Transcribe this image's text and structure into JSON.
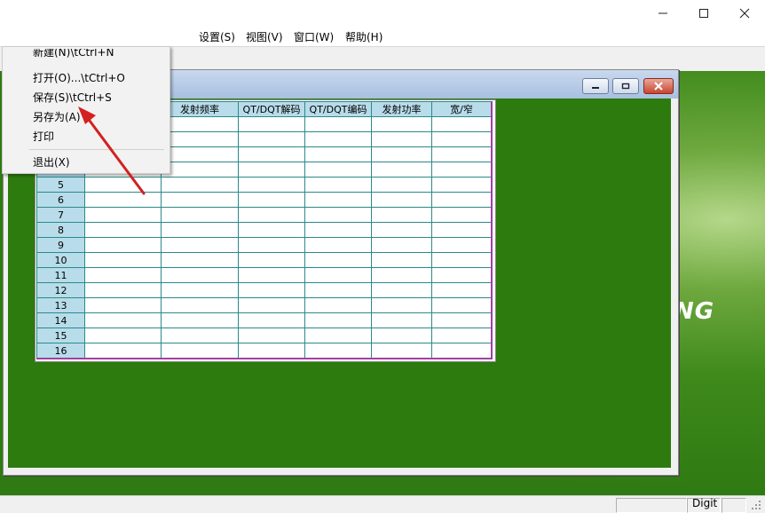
{
  "menubar": {
    "items": [
      "设置(S)",
      "视图(V)",
      "窗口(W)",
      "帮助(H)"
    ]
  },
  "file_menu": {
    "items": [
      "新建(N)\\tCtrl+N",
      "打开(O)...\\tCtrl+O",
      "保存(S)\\tCtrl+S",
      "另存为(A)",
      "打印",
      "退出(X)"
    ]
  },
  "grid": {
    "headers": [
      "",
      "",
      "发射频率",
      "QT/DQT解码",
      "QT/DQT编码",
      "发射功率",
      "宽/窄"
    ],
    "row_numbers": [
      "5",
      "6",
      "7",
      "8",
      "9",
      "10",
      "11",
      "12",
      "13",
      "14",
      "15",
      "16"
    ]
  },
  "background": {
    "logo_text": "NG"
  },
  "statusbar": {
    "mode": "Digit"
  },
  "colors": {
    "grid_header": "#b8dcea",
    "grid_border": "#2a8a8a",
    "grid_frame": "#a040a0",
    "desktop_green": "#2f7a12",
    "arrow": "#d42020"
  }
}
